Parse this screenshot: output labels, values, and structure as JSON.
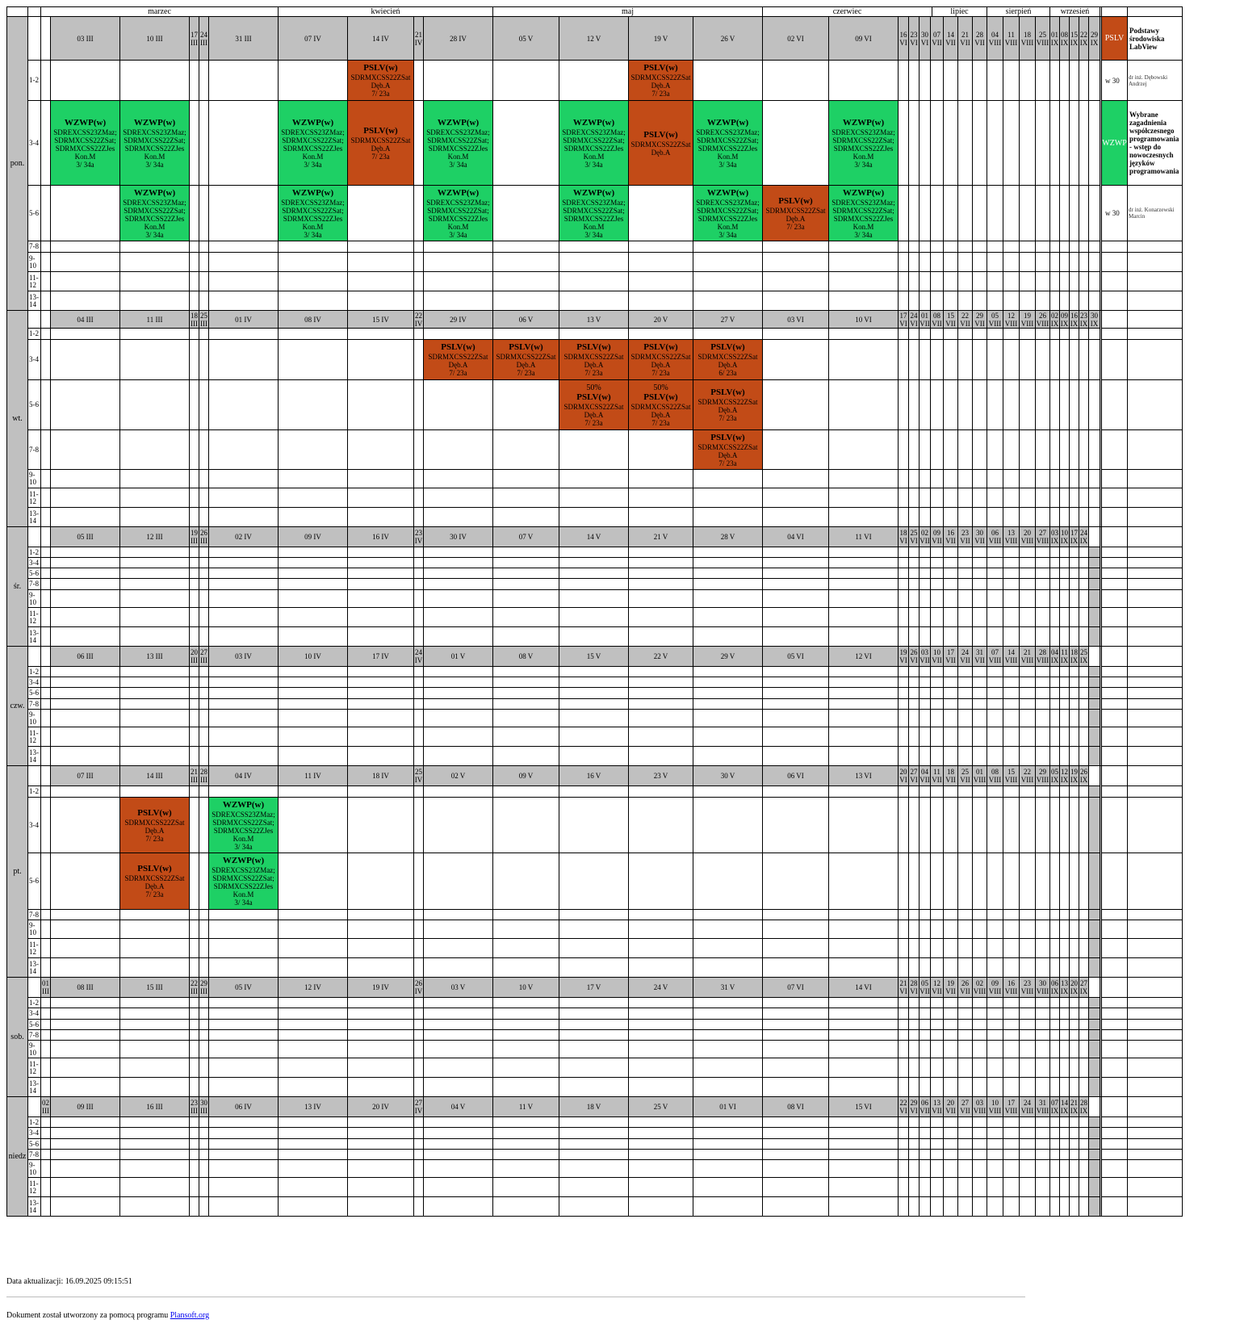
{
  "colors": {
    "PSLV": "#c24b17",
    "WZWP": "#1ed065",
    "header": "#c0c0c0"
  },
  "months": [
    "marzec",
    "kwiecień",
    "maj",
    "czerwiec",
    "lipiec",
    "sierpień",
    "wrzesień"
  ],
  "slots": [
    "1-2",
    "3-4",
    "5-6",
    "7-8",
    "9-10",
    "11-12",
    "13-14"
  ],
  "days": [
    {
      "label": "pon.",
      "pre": "",
      "wide": [
        "03 III",
        "10 III",
        null,
        null,
        "31 III",
        "07 IV",
        "14 IV",
        null,
        "28 IV",
        "05 V",
        "12 V",
        "19 V",
        "26 V",
        "02 VI",
        "09 VI"
      ],
      "narrow": {
        "2": "17 III",
        "3": "24 III",
        "7": "21 IV"
      },
      "tail": [
        "16 VI",
        "23 VI",
        "30 VI",
        "07 VII",
        "14 VII",
        "21 VII",
        "28 VII",
        "04 VIII",
        "11 VIII",
        "18 VIII",
        "25 VIII",
        "01 IX",
        "08 IX",
        "15 IX",
        "22 IX",
        "29 IX"
      ]
    },
    {
      "label": "wt.",
      "pre": "",
      "wide": [
        "04 III",
        "11 III",
        null,
        null,
        "01 IV",
        "08 IV",
        "15 IV",
        null,
        "29 IV",
        "06 V",
        "13 V",
        "20 V",
        "27 V",
        "03 VI",
        "10 VI"
      ],
      "narrow": {
        "2": "18 III",
        "3": "25 III",
        "7": "22 IV"
      },
      "tail": [
        "17 VI",
        "24 VI",
        "01 VII",
        "08 VII",
        "15 VII",
        "22 VII",
        "29 VII",
        "05 VIII",
        "12 VIII",
        "19 VIII",
        "26 VIII",
        "02 IX",
        "09 IX",
        "16 IX",
        "23 IX",
        "30 IX"
      ]
    },
    {
      "label": "śr.",
      "pre": "",
      "wide": [
        "05 III",
        "12 III",
        null,
        null,
        "02 IV",
        "09 IV",
        "16 IV",
        null,
        "30 IV",
        "07 V",
        "14 V",
        "21 V",
        "28 V",
        "04 VI",
        "11 VI"
      ],
      "narrow": {
        "2": "19 III",
        "3": "26 III",
        "7": "23 IV"
      },
      "tail": [
        "18 VI",
        "25 VI",
        "02 VII",
        "09 VII",
        "16 VII",
        "23 VII",
        "30 VII",
        "06 VIII",
        "13 VIII",
        "20 VIII",
        "27 VIII",
        "03 IX",
        "10 IX",
        "17 IX",
        "24 IX"
      ]
    },
    {
      "label": "czw.",
      "pre": "",
      "wide": [
        "06 III",
        "13 III",
        null,
        null,
        "03 IV",
        "10 IV",
        "17 IV",
        null,
        "01 V",
        "08 V",
        "15 V",
        "22 V",
        "29 V",
        "05 VI",
        "12 VI"
      ],
      "narrow": {
        "2": "20 III",
        "3": "27 III",
        "7": "24 IV"
      },
      "tail": [
        "19 VI",
        "26 VI",
        "03 VII",
        "10 VII",
        "17 VII",
        "24 VII",
        "31 VII",
        "07 VIII",
        "14 VIII",
        "21 VIII",
        "28 VIII",
        "04 IX",
        "11 IX",
        "18 IX",
        "25 IX"
      ]
    },
    {
      "label": "pt.",
      "pre": "",
      "wide": [
        "07 III",
        "14 III",
        null,
        null,
        "04 IV",
        "11 IV",
        "18 IV",
        null,
        "02 V",
        "09 V",
        "16 V",
        "23 V",
        "30 V",
        "06 VI",
        "13 VI"
      ],
      "narrow": {
        "2": "21 III",
        "3": "28 III",
        "7": "25 IV"
      },
      "tail": [
        "20 VI",
        "27 VI",
        "04 VII",
        "11 VII",
        "18 VII",
        "25 VII",
        "01 VIII",
        "08 VIII",
        "15 VIII",
        "22 VIII",
        "29 VIII",
        "05 IX",
        "12 IX",
        "19 IX",
        "26 IX"
      ]
    },
    {
      "label": "sob.",
      "pre": "01 III",
      "wide": [
        "08 III",
        "15 III",
        null,
        null,
        "05 IV",
        "12 IV",
        "19 IV",
        null,
        "03 V",
        "10 V",
        "17 V",
        "24 V",
        "31 V",
        "07 VI",
        "14 VI"
      ],
      "narrow": {
        "2": "22 III",
        "3": "29 III",
        "7": "26 IV"
      },
      "tail": [
        "21 VI",
        "28 VI",
        "05 VII",
        "12 VII",
        "19 VII",
        "26 VII",
        "02 VIII",
        "09 VIII",
        "16 VIII",
        "23 VIII",
        "30 VIII",
        "06 IX",
        "13 IX",
        "20 IX",
        "27 IX"
      ]
    },
    {
      "label": "niedz",
      "pre": "02 III",
      "wide": [
        "09 III",
        "16 III",
        null,
        null,
        "06 IV",
        "13 IV",
        "20 IV",
        null,
        "04 V",
        "11 V",
        "18 V",
        "25 V",
        "01 VI",
        "08 VI",
        "15 VI"
      ],
      "narrow": {
        "2": "23 III",
        "3": "30 III",
        "7": "27 IV"
      },
      "tail": [
        "22 VI",
        "29 VI",
        "06 VII",
        "13 VII",
        "20 VII",
        "27 VII",
        "03 VIII",
        "10 VIII",
        "17 VIII",
        "24 VIII",
        "31 VIII",
        "07 IX",
        "14 IX",
        "21 IX",
        "28 IX"
      ]
    }
  ],
  "events": [
    {
      "day": 0,
      "col": 6,
      "slot": 0,
      "span": 1,
      "code": "PSLV",
      "title": "PSLV(w)",
      "groups": "SDRMXCSS22ZSat",
      "teacher": "Dęb.A",
      "room": "7/ 23a"
    },
    {
      "day": 0,
      "col": 11,
      "slot": 0,
      "span": 1,
      "code": "PSLV",
      "title": "PSLV(w)",
      "groups": "SDRMXCSS22ZSat",
      "teacher": "Dęb.A",
      "room": "7/ 23a"
    },
    {
      "day": 0,
      "col": 0,
      "slot": 1,
      "span": 1,
      "code": "WZWP",
      "title": "WZWP(w)",
      "groups": "SDREXCSS23ZMaz;\nSDRMXCSS22ZSat;\nSDRMXCSS22ZJes",
      "teacher": "Kon.M",
      "room": "3/ 34a"
    },
    {
      "day": 0,
      "col": 1,
      "slot": 1,
      "span": 1,
      "code": "WZWP",
      "title": "WZWP(w)",
      "groups": "SDREXCSS23ZMaz;\nSDRMXCSS22ZSat;\nSDRMXCSS22ZJes",
      "teacher": "Kon.M",
      "room": "3/ 34a"
    },
    {
      "day": 0,
      "col": 5,
      "slot": 1,
      "span": 1,
      "code": "WZWP",
      "title": "WZWP(w)",
      "groups": "SDREXCSS23ZMaz;\nSDRMXCSS22ZSat;\nSDRMXCSS22ZJes",
      "teacher": "Kon.M",
      "room": "3/ 34a"
    },
    {
      "day": 0,
      "col": 6,
      "slot": 1,
      "span": 1,
      "code": "PSLV",
      "title": "PSLV(w)",
      "groups": "SDRMXCSS22ZSat",
      "teacher": "Dęb.A",
      "room": "7/ 23a"
    },
    {
      "day": 0,
      "col": 8,
      "slot": 1,
      "span": 1,
      "code": "WZWP",
      "title": "WZWP(w)",
      "groups": "SDREXCSS23ZMaz;\nSDRMXCSS22ZSat;\nSDRMXCSS22ZJes",
      "teacher": "Kon.M",
      "room": "3/ 34a"
    },
    {
      "day": 0,
      "col": 10,
      "slot": 1,
      "span": 1,
      "code": "WZWP",
      "title": "WZWP(w)",
      "groups": "SDREXCSS23ZMaz;\nSDRMXCSS22ZSat;\nSDRMXCSS22ZJes",
      "teacher": "Kon.M",
      "room": "3/ 34a"
    },
    {
      "day": 0,
      "col": 11,
      "slot": 1,
      "span": 1,
      "code": "PSLV",
      "title": "PSLV(w)",
      "groups": "SDRMXCSS22ZSat",
      "teacher": "Dęb.A",
      "room": ""
    },
    {
      "day": 0,
      "col": 12,
      "slot": 1,
      "span": 1,
      "code": "WZWP",
      "title": "WZWP(w)",
      "groups": "SDREXCSS23ZMaz;\nSDRMXCSS22ZSat;\nSDRMXCSS22ZJes",
      "teacher": "Kon.M",
      "room": "3/ 34a"
    },
    {
      "day": 0,
      "col": 14,
      "slot": 1,
      "span": 1,
      "code": "WZWP",
      "title": "WZWP(w)",
      "groups": "SDREXCSS23ZMaz;\nSDRMXCSS22ZSat;\nSDRMXCSS22ZJes",
      "teacher": "Kon.M",
      "room": "3/ 34a"
    },
    {
      "day": 0,
      "col": 1,
      "slot": 2,
      "span": 1,
      "code": "WZWP",
      "title": "WZWP(w)",
      "groups": "SDREXCSS23ZMaz;\nSDRMXCSS22ZSat;\nSDRMXCSS22ZJes",
      "teacher": "Kon.M",
      "room": "3/ 34a"
    },
    {
      "day": 0,
      "col": 5,
      "slot": 2,
      "span": 1,
      "code": "WZWP",
      "title": "WZWP(w)",
      "groups": "SDREXCSS23ZMaz;\nSDRMXCSS22ZSat;\nSDRMXCSS22ZJes",
      "teacher": "Kon.M",
      "room": "3/ 34a"
    },
    {
      "day": 0,
      "col": 8,
      "slot": 2,
      "span": 1,
      "code": "WZWP",
      "title": "WZWP(w)",
      "groups": "SDREXCSS23ZMaz;\nSDRMXCSS22ZSat;\nSDRMXCSS22ZJes",
      "teacher": "Kon.M",
      "room": "3/ 34a"
    },
    {
      "day": 0,
      "col": 10,
      "slot": 2,
      "span": 1,
      "code": "WZWP",
      "title": "WZWP(w)",
      "groups": "SDREXCSS23ZMaz;\nSDRMXCSS22ZSat;\nSDRMXCSS22ZJes",
      "teacher": "Kon.M",
      "room": "3/ 34a"
    },
    {
      "day": 0,
      "col": 12,
      "slot": 2,
      "span": 1,
      "code": "WZWP",
      "title": "WZWP(w)",
      "groups": "SDREXCSS23ZMaz;\nSDRMXCSS22ZSat;\nSDRMXCSS22ZJes",
      "teacher": "Kon.M",
      "room": "3/ 34a"
    },
    {
      "day": 0,
      "col": 13,
      "slot": 2,
      "span": 1,
      "code": "PSLV",
      "title": "PSLV(w)",
      "groups": "SDRMXCSS22ZSat",
      "teacher": "Dęb.A",
      "room": "7/ 23a"
    },
    {
      "day": 0,
      "col": 14,
      "slot": 2,
      "span": 1,
      "code": "WZWP",
      "title": "WZWP(w)",
      "groups": "SDREXCSS23ZMaz;\nSDRMXCSS22ZSat;\nSDRMXCSS22ZJes",
      "teacher": "Kon.M",
      "room": "3/ 34a"
    },
    {
      "day": 1,
      "col": 8,
      "slot": 1,
      "span": 1,
      "code": "PSLV",
      "title": "PSLV(w)",
      "groups": "SDRMXCSS22ZSat",
      "teacher": "Dęb.A",
      "room": "7/ 23a"
    },
    {
      "day": 1,
      "col": 9,
      "slot": 1,
      "span": 1,
      "code": "PSLV",
      "title": "PSLV(w)",
      "groups": "SDRMXCSS22ZSat",
      "teacher": "Dęb.A",
      "room": "7/ 23a"
    },
    {
      "day": 1,
      "col": 10,
      "slot": 1,
      "span": 1,
      "code": "PSLV",
      "title": "PSLV(w)",
      "groups": "SDRMXCSS22ZSat",
      "teacher": "Dęb.A",
      "room": "7/ 23a"
    },
    {
      "day": 1,
      "col": 11,
      "slot": 1,
      "span": 1,
      "code": "PSLV",
      "title": "PSLV(w)",
      "groups": "SDRMXCSS22ZSat",
      "teacher": "Dęb.A",
      "room": "7/ 23a"
    },
    {
      "day": 1,
      "col": 12,
      "slot": 1,
      "span": 1,
      "code": "PSLV",
      "title": "PSLV(w)",
      "groups": "SDRMXCSS22ZSat",
      "teacher": "Dęb.A",
      "room": "6/ 23a"
    },
    {
      "day": 1,
      "col": 10,
      "slot": 2,
      "span": 1,
      "code": "PSLV",
      "title": "PSLV(w)",
      "pct": "50%",
      "groups": "SDRMXCSS22ZSat",
      "teacher": "Dęb.A",
      "room": "7/ 23a"
    },
    {
      "day": 1,
      "col": 11,
      "slot": 2,
      "span": 1,
      "code": "PSLV",
      "title": "PSLV(w)",
      "pct": "50%",
      "groups": "SDRMXCSS22ZSat",
      "teacher": "Dęb.A",
      "room": "7/ 23a"
    },
    {
      "day": 1,
      "col": 12,
      "slot": 2,
      "span": 1,
      "code": "PSLV",
      "title": "PSLV(w)",
      "groups": "SDRMXCSS22ZSat",
      "teacher": "Dęb.A",
      "room": "7/ 23a"
    },
    {
      "day": 1,
      "col": 12,
      "slot": 3,
      "span": 1,
      "code": "PSLV",
      "title": "PSLV(w)",
      "groups": "SDRMXCSS22ZSat",
      "teacher": "Dęb.A",
      "room": "7/ 23a"
    },
    {
      "day": 4,
      "col": 1,
      "slot": 1,
      "span": 1,
      "code": "PSLV",
      "title": "PSLV(w)",
      "groups": "SDRMXCSS22ZSat",
      "teacher": "Dęb.A",
      "room": "7/ 23a"
    },
    {
      "day": 4,
      "col": 1,
      "slot": 2,
      "span": 1,
      "code": "PSLV",
      "title": "PSLV(w)",
      "groups": "SDRMXCSS22ZSat",
      "teacher": "Dęb.A",
      "room": "7/ 23a"
    },
    {
      "day": 4,
      "col": 4,
      "slot": 1,
      "span": 1,
      "code": "WZWP",
      "title": "WZWP(w)",
      "groups": "SDREXCSS23ZMaz;\nSDRMXCSS22ZSat;\nSDRMXCSS22ZJes",
      "teacher": "Kon.M",
      "room": "3/ 34a"
    },
    {
      "day": 4,
      "col": 4,
      "slot": 2,
      "span": 1,
      "code": "WZWP",
      "title": "WZWP(w)",
      "groups": "SDREXCSS23ZMaz;\nSDRMXCSS22ZSat;\nSDRMXCSS22ZJes",
      "teacher": "Kon.M",
      "room": "3/ 34a"
    }
  ],
  "legend": [
    {
      "code": "PSLV",
      "name": "Podstawy środowiska LabView",
      "hours": "w 30",
      "teacher": "dr inż. Dębowski Andrzej"
    },
    {
      "code": "WZWP",
      "name": "Wybrane zagadnienia współczesnego programowania - wstęp do nowoczesnych języków programowania",
      "hours": "w 30",
      "teacher": "dr inż. Konarzewski Marcin"
    }
  ],
  "footer": {
    "date_label": "Data aktualizacji: 16.09.2025 09:15:51",
    "credit_prefix": "Dokument został utworzony za pomocą programu ",
    "credit_link": "Plansoft.org"
  }
}
